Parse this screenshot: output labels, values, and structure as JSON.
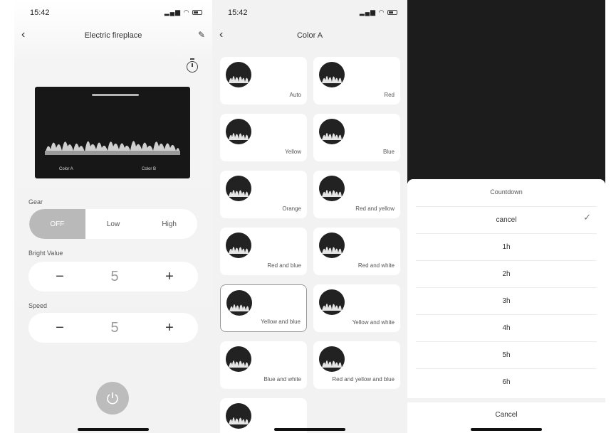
{
  "status_bar": {
    "time": "15:42"
  },
  "control_screen": {
    "title": "Electric fireplace",
    "preview_labels": [
      "Color A",
      "Color B"
    ],
    "gear": {
      "label": "Gear",
      "options": [
        "OFF",
        "Low",
        "High"
      ],
      "selected": "OFF"
    },
    "bright": {
      "label": "Bright Value",
      "value": "5"
    },
    "speed": {
      "label": "Speed",
      "value": "5"
    },
    "accent": "#bcbcbc"
  },
  "color_screen": {
    "title": "Color A",
    "options": [
      "Auto",
      "Red",
      "Yellow",
      "Blue",
      "Orange",
      "Red and yellow",
      "Red and blue",
      "Red and white",
      "Yellow and blue",
      "Yellow and white",
      "Blue and white",
      "Red and yellow and blue",
      ""
    ],
    "selected": "Yellow and blue"
  },
  "countdown_sheet": {
    "title": "Countdown",
    "options": [
      "cancel",
      "1h",
      "2h",
      "3h",
      "4h",
      "5h",
      "6h"
    ],
    "selected": "cancel",
    "cancel_label": "Cancel"
  }
}
